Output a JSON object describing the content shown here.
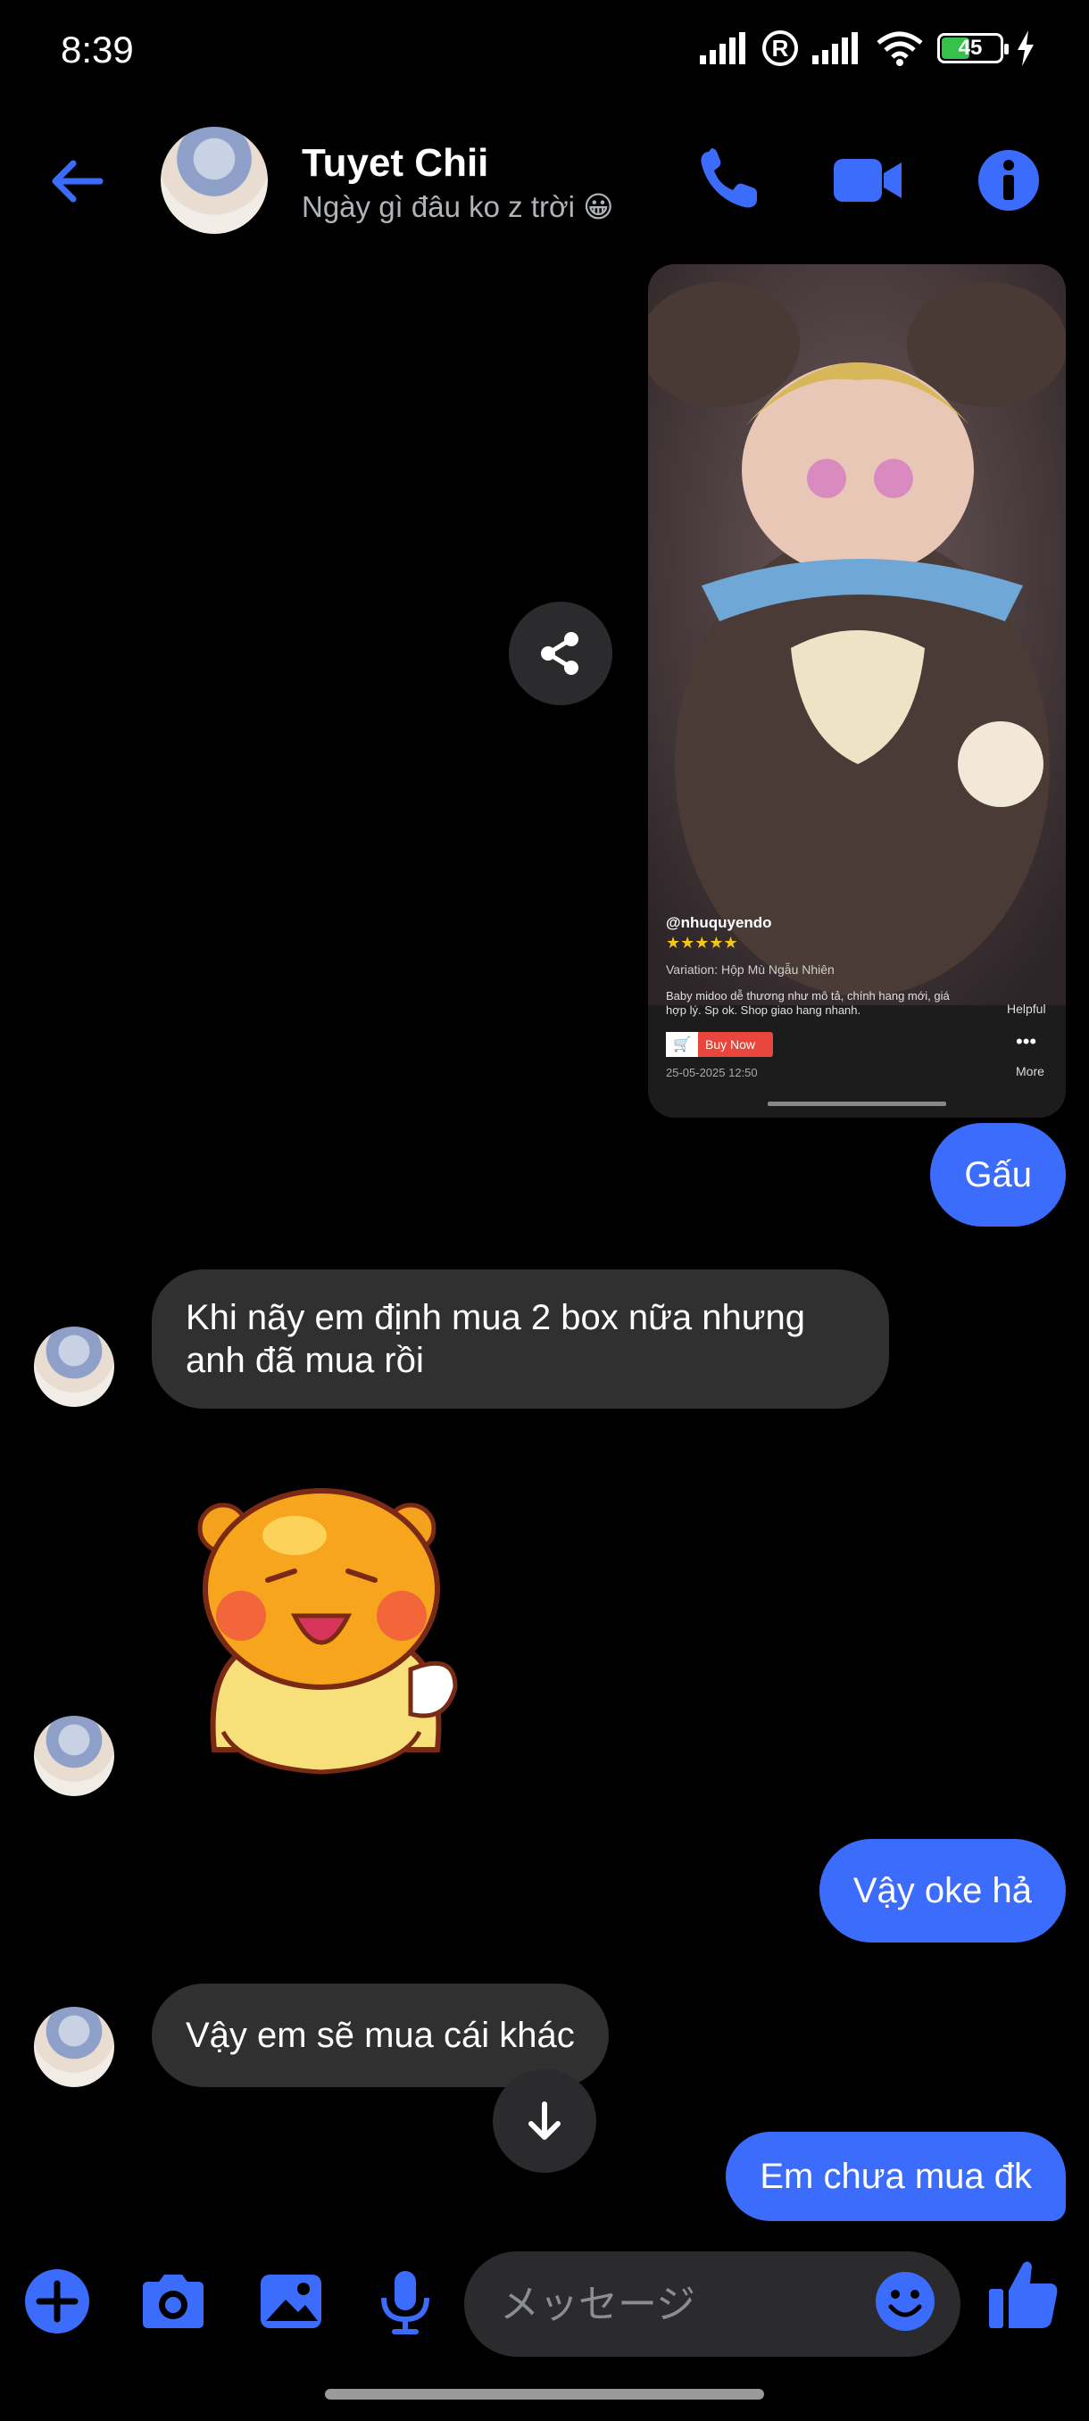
{
  "status_bar": {
    "time": "8:39",
    "battery": "45"
  },
  "header": {
    "contact_name": "Tuyet Chii",
    "contact_status": "Ngày gì đâu ko z trời 😀"
  },
  "shared_post": {
    "username": "@nhuquyendo",
    "stars": "★★★★★",
    "variation": "Variation: Hộp Mù Ngẫu Nhiên",
    "review": "Baby midoo dễ thương như mô tả, chính hang mới, giá hợp lý. Sp ok. Shop giao hang nhanh.",
    "buy_now": "Buy Now",
    "timestamp": "25-05-2025 12:50",
    "helpful_label": "Helpful",
    "more_label": "More"
  },
  "messages": [
    {
      "sender": "me",
      "text": "Gấu"
    },
    {
      "sender": "them",
      "text": "Khi nãy em định mua 2 box nữa nhưng anh đã mua rồi"
    },
    {
      "sender": "them",
      "type": "sticker"
    },
    {
      "sender": "me",
      "text": "Vậy oke hả"
    },
    {
      "sender": "them",
      "text": "Vậy em sẽ mua cái khác"
    },
    {
      "sender": "me",
      "text": "Em chưa mua đk"
    }
  ],
  "composer": {
    "placeholder": "メッセージ"
  },
  "colors": {
    "accent": "#3b6cfb",
    "background": "#000000",
    "incoming_bubble": "#303030"
  },
  "icons": [
    "back-arrow-icon",
    "phone-icon",
    "video-icon",
    "info-icon",
    "share-icon",
    "arrow-down-icon",
    "plus-icon",
    "camera-icon",
    "image-icon",
    "mic-icon",
    "emoji-icon",
    "like-icon"
  ]
}
